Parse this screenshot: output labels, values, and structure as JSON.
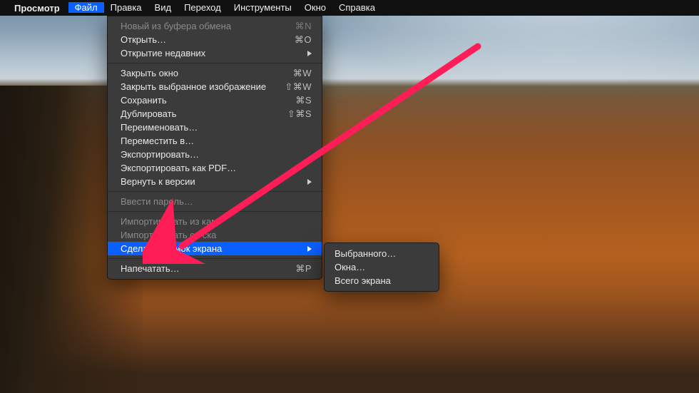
{
  "menubar": {
    "apple_icon": "",
    "app_name": "Просмотр",
    "items": [
      "Файл",
      "Правка",
      "Вид",
      "Переход",
      "Инструменты",
      "Окно",
      "Справка"
    ],
    "active_index": 0
  },
  "file_menu": {
    "groups": [
      [
        {
          "label": "Новый из буфера обмена",
          "shortcut": "⌘N",
          "disabled": true
        },
        {
          "label": "Открыть…",
          "shortcut": "⌘O"
        },
        {
          "label": "Открытие недавних",
          "submenu": true
        }
      ],
      [
        {
          "label": "Закрыть окно",
          "shortcut": "⌘W"
        },
        {
          "label": "Закрыть выбранное изображение",
          "shortcut": "⇧⌘W"
        },
        {
          "label": "Сохранить",
          "shortcut": "⌘S"
        },
        {
          "label": "Дублировать",
          "shortcut": "⇧⌘S"
        },
        {
          "label": "Переименовать…"
        },
        {
          "label": "Переместить в…"
        },
        {
          "label": "Экспортировать…"
        },
        {
          "label": "Экспортировать как PDF…"
        },
        {
          "label": "Вернуть к версии",
          "submenu": true
        }
      ],
      [
        {
          "label": "Ввести пароль…",
          "disabled": true
        }
      ],
      [
        {
          "label": "Импортировать из кам",
          "disabled": true
        },
        {
          "label": "Импортировать со ска",
          "disabled": true
        },
        {
          "label": "Сделать снимок экрана",
          "submenu": true,
          "highlight": true
        }
      ],
      [
        {
          "label": "Напечатать…",
          "shortcut": "⌘P"
        }
      ]
    ]
  },
  "screenshot_submenu": {
    "items": [
      {
        "label": "Выбранного…"
      },
      {
        "label": "Окна…"
      },
      {
        "label": "Всего экрана"
      }
    ]
  },
  "annotation": {
    "arrow_color": "#ff1d58"
  }
}
